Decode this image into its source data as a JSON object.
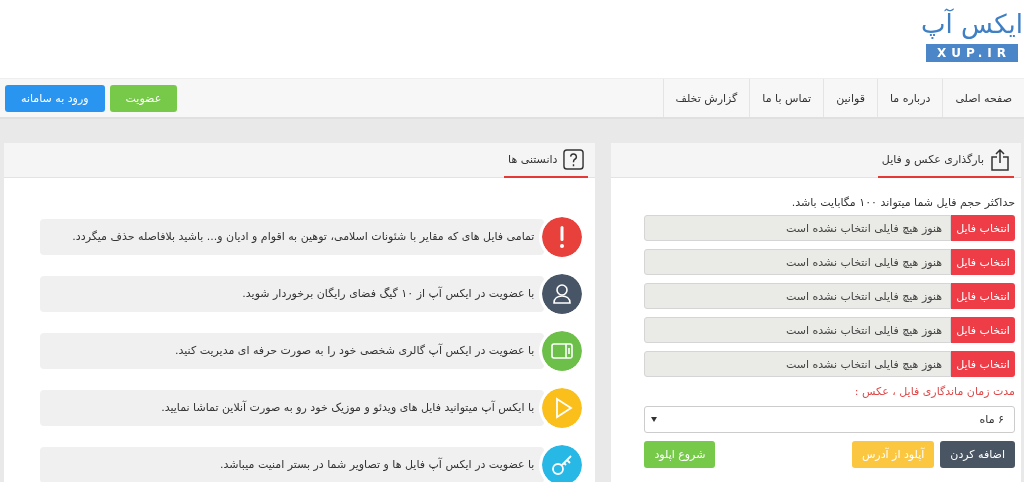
{
  "logo": {
    "title": "ایکس آپ",
    "domain": "XUP.IR"
  },
  "nav": [
    {
      "label": "صفحه اصلی"
    },
    {
      "label": "درباره ما"
    },
    {
      "label": "قوانین"
    },
    {
      "label": "تماس با ما"
    },
    {
      "label": "گزارش تخلف"
    }
  ],
  "auth_buttons": [
    {
      "label": "عضویت",
      "kind": "success"
    },
    {
      "label": "ورود به سامانه",
      "kind": "primary"
    }
  ],
  "upload": {
    "tab": "بارگذاری عکس و فایل",
    "note": "حداکثر حجم فایل شما میتواند ۱۰۰ مگابایت باشد.",
    "files": [
      {
        "button": "انتخاب فایل",
        "placeholder": "هنوز هیچ فایلی انتخاب نشده است"
      },
      {
        "button": "انتخاب فایل",
        "placeholder": "هنوز هیچ فایلی انتخاب نشده است"
      },
      {
        "button": "انتخاب فایل",
        "placeholder": "هنوز هیچ فایلی انتخاب نشده است"
      },
      {
        "button": "انتخاب فایل",
        "placeholder": "هنوز هیچ فایلی انتخاب نشده است"
      },
      {
        "button": "انتخاب فایل",
        "placeholder": "هنوز هیچ فایلی انتخاب نشده است"
      }
    ],
    "duration_label": "مدت زمان ماندگاری فایل ، عکس :",
    "duration": "۶ ماه",
    "buttons": [
      {
        "label": "اضافه کردن",
        "kind": "dark"
      },
      {
        "label": "آپلود از آدرس",
        "kind": "warning"
      },
      {
        "label": "شروع اپلود",
        "kind": "success"
      }
    ]
  },
  "tips": {
    "tab": "دانستنی ها",
    "items": [
      {
        "kind": "alert",
        "color": "#e8413c",
        "text": "تمامی فایل های که مقایر با شئونات اسلامی، توهین به اقوام و ادیان و... باشید بلافاصله حذف میگردد."
      },
      {
        "kind": "user",
        "color": "#475566",
        "text": "با عضویت در ایکس آپ از ۱۰ گیگ فضای رایگان برخوردار شوید."
      },
      {
        "kind": "gallery",
        "color": "#6cc04a",
        "text": "با عضویت در ایکس آپ گالری شخصی خود را به صورت حرفه ای مدیریت کنید."
      },
      {
        "kind": "play",
        "color": "#fbbf1c",
        "text": "با ایکس آپ میتوانید فایل های ویدئو و موزیک خود رو به صورت آنلاین تماشا نمایید."
      },
      {
        "kind": "key",
        "color": "#27b8e6",
        "text": "با عضویت در ایکس آپ فایل ها و تصاویر شما در بستر امنیت میباشد."
      }
    ]
  }
}
